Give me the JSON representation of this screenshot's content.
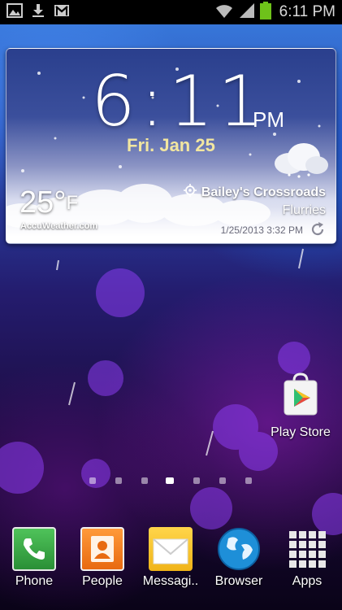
{
  "status_bar": {
    "time": "6:11 PM",
    "icons": [
      "gallery-icon",
      "download-icon",
      "gmail-icon",
      "wifi-icon",
      "signal-icon",
      "battery-icon"
    ]
  },
  "weather_widget": {
    "time": "6:11",
    "ampm": "PM",
    "date": "Fri. Jan 25",
    "temperature": "25°",
    "unit": "F",
    "brand": "AccuWeather.com",
    "location": "Bailey's Crossroads",
    "condition": "Flurries",
    "updated": "1/25/2013 3:32 PM"
  },
  "desktop_icons": [
    {
      "label": "Play Store",
      "icon": "play-store-icon"
    }
  ],
  "page_indicator": {
    "count": 7,
    "active_index": 3
  },
  "dock": {
    "items": [
      {
        "label": "Phone",
        "icon": "phone-icon"
      },
      {
        "label": "People",
        "icon": "people-icon"
      },
      {
        "label": "Messagi..",
        "icon": "messaging-icon"
      },
      {
        "label": "Browser",
        "icon": "browser-icon"
      },
      {
        "label": "Apps",
        "icon": "apps-grid-icon"
      }
    ]
  },
  "colors": {
    "status_bar_bg": "#000000",
    "date_accent": "#f2e6a0",
    "battery_green": "#6ec21a"
  }
}
